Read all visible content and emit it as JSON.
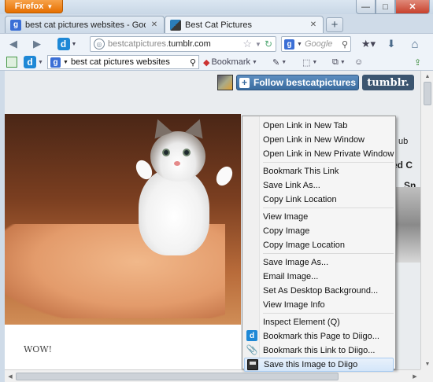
{
  "window": {
    "app_button_label": "Firefox",
    "minimize_glyph": "—",
    "maximize_glyph": "□",
    "close_glyph": "✕"
  },
  "tabs": [
    {
      "label": "best cat pictures websites - Google Se...",
      "favicon": "google-g",
      "favicon_glyph": "g"
    },
    {
      "label": "Best Cat Pictures",
      "favicon": "tumblr-cat"
    }
  ],
  "new_tab_label": "+",
  "navbar": {
    "url_host": "bestcatpictures.",
    "url_domain": "tumblr.com",
    "search_engine_glyph": "g",
    "search_placeholder": "Google",
    "back_glyph": "◀",
    "forward_glyph": "▶",
    "identity_glyph": "◎",
    "star_glyph": "☆",
    "reload_glyph": "↻",
    "search_glyph": "⚲",
    "bookmarks_glyph": "★▾",
    "download_glyph": "⬇",
    "home_glyph": "⌂"
  },
  "addonbar": {
    "diigo_glyph": "d",
    "diigo_search_engine_glyph": "g",
    "diigo_search_value": "best cat pictures websites",
    "diigo_search_glyph": "⚲",
    "bookmark_label": "Bookmark",
    "highlight_glyph": "✎",
    "capture_glyph": "⬚",
    "read_later_glyph": "⧉",
    "sticky_glyph": "☺",
    "share_glyph": "⇪"
  },
  "tumblr": {
    "follow_label": "Follow bestcatpictures",
    "logo_text": "tumblr."
  },
  "page": {
    "caption": "WOW!",
    "right_snippets": [
      "d Ca",
      "Sno",
      "ub"
    ],
    "right_snippets_bold": [
      "ed C",
      "Sn"
    ]
  },
  "context_menu": {
    "items": [
      {
        "label": "Open Link in New Tab",
        "icon": null
      },
      {
        "label": "Open Link in New Window",
        "icon": null
      },
      {
        "label": "Open Link in New Private Window",
        "icon": null
      },
      {
        "separator": true
      },
      {
        "label": "Bookmark This Link",
        "icon": null
      },
      {
        "label": "Save Link As...",
        "icon": null
      },
      {
        "label": "Copy Link Location",
        "icon": null
      },
      {
        "separator": true
      },
      {
        "label": "View Image",
        "icon": null
      },
      {
        "label": "Copy Image",
        "icon": null
      },
      {
        "label": "Copy Image Location",
        "icon": null
      },
      {
        "separator": true
      },
      {
        "label": "Save Image As...",
        "icon": null
      },
      {
        "label": "Email Image...",
        "icon": null
      },
      {
        "label": "Set As Desktop Background...",
        "icon": null
      },
      {
        "label": "View Image Info",
        "icon": null
      },
      {
        "separator": true
      },
      {
        "label": "Inspect Element (Q)",
        "icon": null
      },
      {
        "label": "Bookmark this Page to Diigo...",
        "icon": "diigo-d-icon",
        "icon_glyph": "d"
      },
      {
        "label": "Bookmark this Link to Diigo...",
        "icon": "paperclip-icon",
        "icon_glyph": "📎"
      },
      {
        "label": "Save this Image to Diigo",
        "icon": "floppy-disk-icon",
        "highlighted": true
      }
    ]
  },
  "colors": {
    "firefox_orange": "#e66f00",
    "follow_blue": "#3a6c9f",
    "tumblr_navy": "#3b5570",
    "diigo_blue": "#1e88d6",
    "menu_highlight": "#d4e6f9"
  }
}
